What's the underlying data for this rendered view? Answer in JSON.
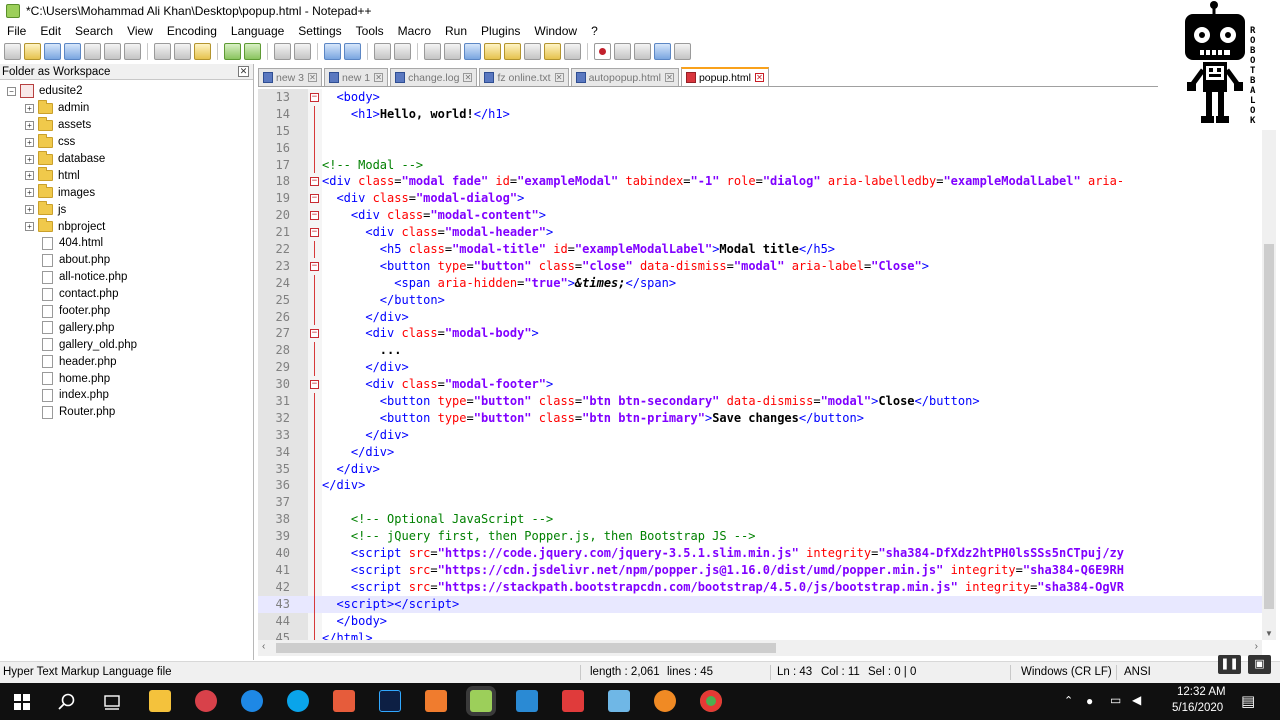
{
  "window": {
    "title": "*C:\\Users\\Mohammad Ali Khan\\Desktop\\popup.html - Notepad++"
  },
  "menu": [
    "File",
    "Edit",
    "Search",
    "View",
    "Encoding",
    "Language",
    "Settings",
    "Tools",
    "Macro",
    "Run",
    "Plugins",
    "Window",
    "?"
  ],
  "workspace": {
    "header": "Folder as Workspace",
    "close_glyph": "✕",
    "root": "edusite2",
    "folders": [
      "admin",
      "assets",
      "css",
      "database",
      "html",
      "images",
      "js",
      "nbproject"
    ],
    "files": [
      "404.html",
      "about.php",
      "all-notice.php",
      "contact.php",
      "footer.php",
      "gallery.php",
      "gallery_old.php",
      "header.php",
      "home.php",
      "index.php",
      "Router.php"
    ]
  },
  "tabs": [
    {
      "label": "new 3",
      "active": false
    },
    {
      "label": "new 1",
      "active": false
    },
    {
      "label": "change.log",
      "active": false
    },
    {
      "label": "fz online.txt",
      "active": false
    },
    {
      "label": "autopopup.html",
      "active": false
    },
    {
      "label": "popup.html",
      "active": true
    }
  ],
  "editor": {
    "lines": [
      {
        "n": "13",
        "fold": "box",
        "html": "  <span class=\"t-tag\">&lt;body&gt;</span>"
      },
      {
        "n": "14",
        "fold": "line",
        "html": "    <span class=\"t-tag\">&lt;h1&gt;</span><span class=\"t-txt\">Hello, world!</span><span class=\"t-tag\">&lt;/h1&gt;</span>"
      },
      {
        "n": "15",
        "fold": "line",
        "html": ""
      },
      {
        "n": "16",
        "fold": "line",
        "html": ""
      },
      {
        "n": "17",
        "fold": "line",
        "html": "<span class=\"t-cmt\">&lt;!-- Modal --&gt;</span>"
      },
      {
        "n": "18",
        "fold": "box",
        "html": "<span class=\"t-tag\">&lt;div </span><span class=\"t-attr\">class</span>=<span class=\"t-val\">\"modal fade\"</span> <span class=\"t-attr\">id</span>=<span class=\"t-val\">\"exampleModal\"</span> <span class=\"t-attr\">tabindex</span>=<span class=\"t-val\">\"-1\"</span> <span class=\"t-attr\">role</span>=<span class=\"t-val\">\"dialog\"</span> <span class=\"t-attr\">aria-labelledby</span>=<span class=\"t-val\">\"exampleModalLabel\"</span> <span class=\"t-attr\">aria-</span>"
      },
      {
        "n": "19",
        "fold": "box",
        "html": "  <span class=\"t-tag\">&lt;div </span><span class=\"t-attr\">class</span>=<span class=\"t-val\">\"modal-dialog\"</span><span class=\"t-tag\">&gt;</span>"
      },
      {
        "n": "20",
        "fold": "box",
        "html": "    <span class=\"t-tag\">&lt;div </span><span class=\"t-attr\">class</span>=<span class=\"t-val\">\"modal-content\"</span><span class=\"t-tag\">&gt;</span>"
      },
      {
        "n": "21",
        "fold": "box",
        "html": "      <span class=\"t-tag\">&lt;div </span><span class=\"t-attr\">class</span>=<span class=\"t-val\">\"modal-header\"</span><span class=\"t-tag\">&gt;</span>"
      },
      {
        "n": "22",
        "fold": "line",
        "html": "        <span class=\"t-tag\">&lt;h5 </span><span class=\"t-attr\">class</span>=<span class=\"t-val\">\"modal-title\"</span> <span class=\"t-attr\">id</span>=<span class=\"t-val\">\"exampleModalLabel\"</span><span class=\"t-tag\">&gt;</span><span class=\"t-txt\">Modal title</span><span class=\"t-tag\">&lt;/h5&gt;</span>"
      },
      {
        "n": "23",
        "fold": "box",
        "html": "        <span class=\"t-tag\">&lt;button </span><span class=\"t-attr\">type</span>=<span class=\"t-val\">\"button\"</span> <span class=\"t-attr\">class</span>=<span class=\"t-val\">\"close\"</span> <span class=\"t-attr\">data-dismiss</span>=<span class=\"t-val\">\"modal\"</span> <span class=\"t-attr\">aria-label</span>=<span class=\"t-val\">\"Close\"</span><span class=\"t-tag\">&gt;</span>"
      },
      {
        "n": "24",
        "fold": "line",
        "html": "          <span class=\"t-tag\">&lt;span </span><span class=\"t-attr\">aria-hidden</span>=<span class=\"t-val\">\"true\"</span><span class=\"t-tag\">&gt;</span><span class=\"t-ent\">&amp;times;</span><span class=\"t-tag\">&lt;/span&gt;</span>"
      },
      {
        "n": "25",
        "fold": "line",
        "html": "        <span class=\"t-tag\">&lt;/button&gt;</span>"
      },
      {
        "n": "26",
        "fold": "line",
        "html": "      <span class=\"t-tag\">&lt;/div&gt;</span>"
      },
      {
        "n": "27",
        "fold": "box",
        "html": "      <span class=\"t-tag\">&lt;div </span><span class=\"t-attr\">class</span>=<span class=\"t-val\">\"modal-body\"</span><span class=\"t-tag\">&gt;</span>"
      },
      {
        "n": "28",
        "fold": "line",
        "html": "        <span class=\"t-txt\">...</span>"
      },
      {
        "n": "29",
        "fold": "line",
        "html": "      <span class=\"t-tag\">&lt;/div&gt;</span>"
      },
      {
        "n": "30",
        "fold": "box",
        "html": "      <span class=\"t-tag\">&lt;div </span><span class=\"t-attr\">class</span>=<span class=\"t-val\">\"modal-footer\"</span><span class=\"t-tag\">&gt;</span>"
      },
      {
        "n": "31",
        "fold": "line",
        "html": "        <span class=\"t-tag\">&lt;button </span><span class=\"t-attr\">type</span>=<span class=\"t-val\">\"button\"</span> <span class=\"t-attr\">class</span>=<span class=\"t-val\">\"btn btn-secondary\"</span> <span class=\"t-attr\">data-dismiss</span>=<span class=\"t-val\">\"modal\"</span><span class=\"t-tag\">&gt;</span><span class=\"t-txt\">Close</span><span class=\"t-tag\">&lt;/button&gt;</span>"
      },
      {
        "n": "32",
        "fold": "line",
        "html": "        <span class=\"t-tag\">&lt;button </span><span class=\"t-attr\">type</span>=<span class=\"t-val\">\"button\"</span> <span class=\"t-attr\">class</span>=<span class=\"t-val\">\"btn btn-primary\"</span><span class=\"t-tag\">&gt;</span><span class=\"t-txt\">Save changes</span><span class=\"t-tag\">&lt;/button&gt;</span>"
      },
      {
        "n": "33",
        "fold": "line",
        "html": "      <span class=\"t-tag\">&lt;/div&gt;</span>"
      },
      {
        "n": "34",
        "fold": "line",
        "html": "    <span class=\"t-tag\">&lt;/div&gt;</span>"
      },
      {
        "n": "35",
        "fold": "line",
        "html": "  <span class=\"t-tag\">&lt;/div&gt;</span>"
      },
      {
        "n": "36",
        "fold": "line",
        "html": "<span class=\"t-tag\">&lt;/div&gt;</span>"
      },
      {
        "n": "37",
        "fold": "line",
        "html": ""
      },
      {
        "n": "38",
        "fold": "line",
        "html": "    <span class=\"t-cmt\">&lt;!-- Optional JavaScript --&gt;</span>"
      },
      {
        "n": "39",
        "fold": "line",
        "html": "    <span class=\"t-cmt\">&lt;!-- jQuery first, then Popper.js, then Bootstrap JS --&gt;</span>"
      },
      {
        "n": "40",
        "fold": "line",
        "html": "    <span class=\"t-tag\">&lt;script </span><span class=\"t-attr\">src</span>=<span class=\"t-val\">\"https://code.jquery.com/jquery-3.5.1.slim.min.js\"</span> <span class=\"t-attr\">integrity</span>=<span class=\"t-val\">\"sha384-DfXdz2htPH0lsSSs5nCTpuj/zy</span>"
      },
      {
        "n": "41",
        "fold": "line",
        "html": "    <span class=\"t-tag\">&lt;script </span><span class=\"t-attr\">src</span>=<span class=\"t-val\">\"https://cdn.jsdelivr.net/npm/popper.js@1.16.0/dist/umd/popper.min.js\"</span> <span class=\"t-attr\">integrity</span>=<span class=\"t-val\">\"sha384-Q6E9RH</span>"
      },
      {
        "n": "42",
        "fold": "line",
        "html": "    <span class=\"t-tag\">&lt;script </span><span class=\"t-attr\">src</span>=<span class=\"t-val\">\"https://stackpath.bootstrapcdn.com/bootstrap/4.5.0/js/bootstrap.min.js\"</span> <span class=\"t-attr\">integrity</span>=<span class=\"t-val\">\"sha384-OgVR</span>"
      },
      {
        "n": "43",
        "fold": "line",
        "cur": true,
        "html": "  <span class=\"t-tag\">&lt;script&gt;&lt;/script&gt;</span>"
      },
      {
        "n": "44",
        "fold": "line",
        "html": "  <span class=\"t-tag\">&lt;/body&gt;</span>"
      },
      {
        "n": "45",
        "fold": "line",
        "html": "<span class=\"t-tag\">&lt;/html&gt;</span>"
      }
    ]
  },
  "statusbar": {
    "filetype": "Hyper Text Markup Language file",
    "length": "length : 2,061",
    "lines": "lines : 45",
    "ln": "Ln : 43",
    "col": "Col : 11",
    "sel": "Sel : 0 | 0",
    "eol": "Windows (CR LF)",
    "encoding": "ANSI"
  },
  "tray": {
    "time": "12:32 AM",
    "date": "5/16/2020"
  },
  "logo": {
    "text": "ROBOT BALOK"
  },
  "colors": {
    "tag": "#0000ff",
    "attr": "#ff0000",
    "value": "#8000ff",
    "comment": "#008000",
    "active_tab_accent": "#f9a11b"
  }
}
